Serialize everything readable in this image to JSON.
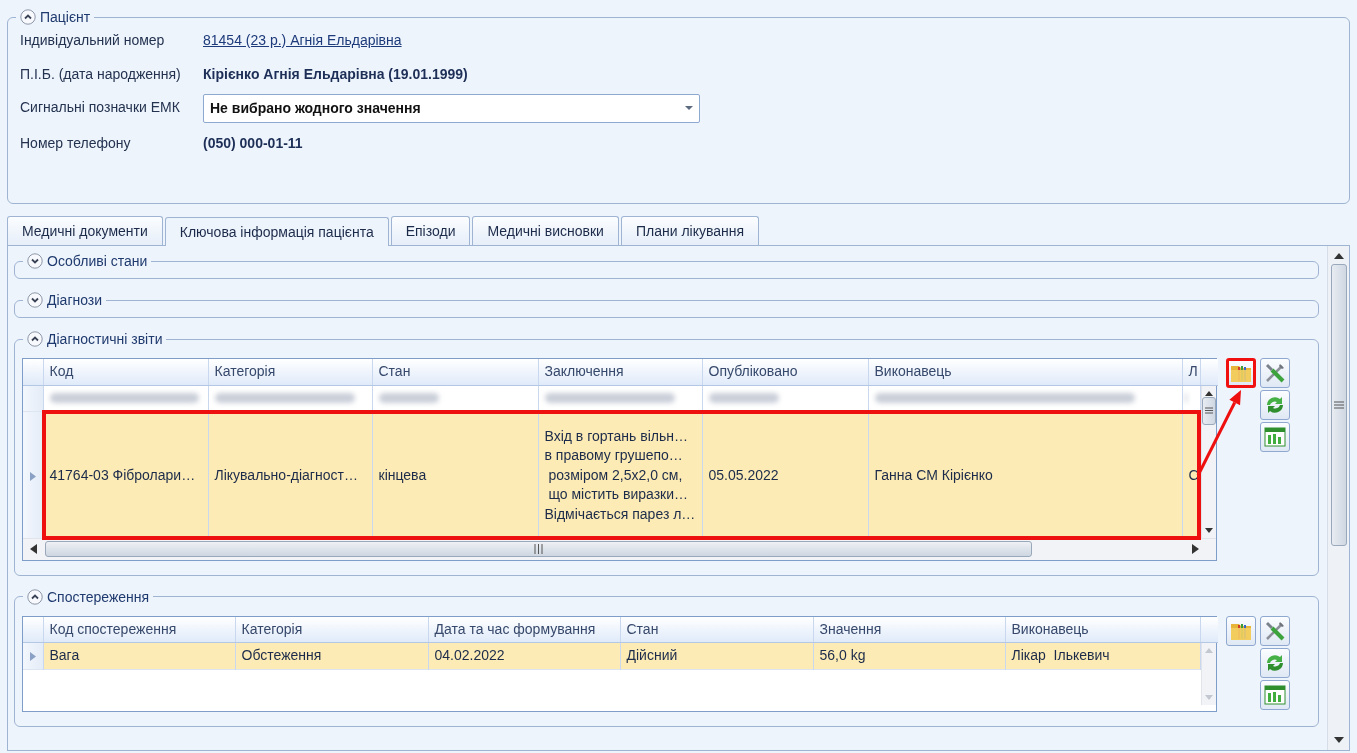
{
  "patient_panel": {
    "title": "Пацієнт",
    "expanded": true,
    "fields": [
      {
        "label": "Індивідуальний номер",
        "value": "81454 (23 р.) Агнія Ельдарівна",
        "kind": "link"
      },
      {
        "label": "П.І.Б. (дата народження)",
        "value": "Кірієнко Агнія Ельдарівна (19.01.1999)",
        "kind": "text"
      },
      {
        "label": "Сигнальні позначки ЕМК",
        "value": "Не вибрано жодного значення",
        "kind": "dropdown"
      },
      {
        "label": "Номер телефону",
        "value": "(050) 000-01-11",
        "kind": "text"
      }
    ]
  },
  "tabs": [
    {
      "label": "Медичні документи",
      "selected": false
    },
    {
      "label": "Ключова інформація пацієнта",
      "selected": true
    },
    {
      "label": "Епізоди",
      "selected": false
    },
    {
      "label": "Медичні висновки",
      "selected": false
    },
    {
      "label": "Плани лікування",
      "selected": false
    }
  ],
  "sections": [
    {
      "title": "Особливі стани",
      "expanded": false
    },
    {
      "title": "Діагнози",
      "expanded": false
    },
    {
      "title": "Діагностичні звіти",
      "expanded": true,
      "grid": {
        "columns": [
          "Код",
          "Категорія",
          "Стан",
          "Заключення",
          "Опубліковано",
          "Виконавець",
          "Л"
        ],
        "rows": [
          {
            "blurred": true,
            "selected": false,
            "highlighted": false
          },
          {
            "blurred": false,
            "selected": true,
            "highlighted": true,
            "cells": [
              "41764-03 Фібролари…",
              "Лікувально-діагност…",
              "кінцева",
              "Вхід в гортань вільн…\nв правому грушепо…\n розміром 2,5х2,0 см,\n що містить виразки…\nВідмічається парез л…",
              "05.05.2022",
              "Ганна СМ Кірієнко",
              "С"
            ]
          }
        ]
      },
      "toolbar": [
        {
          "kind": "folder",
          "highlighted": true
        },
        {
          "kind": "tools",
          "highlighted": false
        },
        {
          "kind": "refresh",
          "highlighted": false
        },
        {
          "kind": "sheet",
          "highlighted": false
        }
      ]
    },
    {
      "title": "Спостереження",
      "expanded": true,
      "grid": {
        "columns": [
          "Код спостереження",
          "Категорія",
          "Дата та час формування",
          "Стан",
          "Значення",
          "Виконавець"
        ],
        "rows": [
          {
            "blurred": false,
            "selected": true,
            "highlighted": false,
            "cells": [
              "Вага",
              "Обстеження",
              "04.02.2022",
              "Дійсний",
              "56,0 kg",
              "Лікар  Ількевич"
            ]
          }
        ]
      },
      "toolbar": [
        {
          "kind": "folder",
          "highlighted": false
        },
        {
          "kind": "tools",
          "highlighted": false
        },
        {
          "kind": "refresh",
          "highlighted": false
        },
        {
          "kind": "sheet",
          "highlighted": false
        }
      ]
    }
  ]
}
